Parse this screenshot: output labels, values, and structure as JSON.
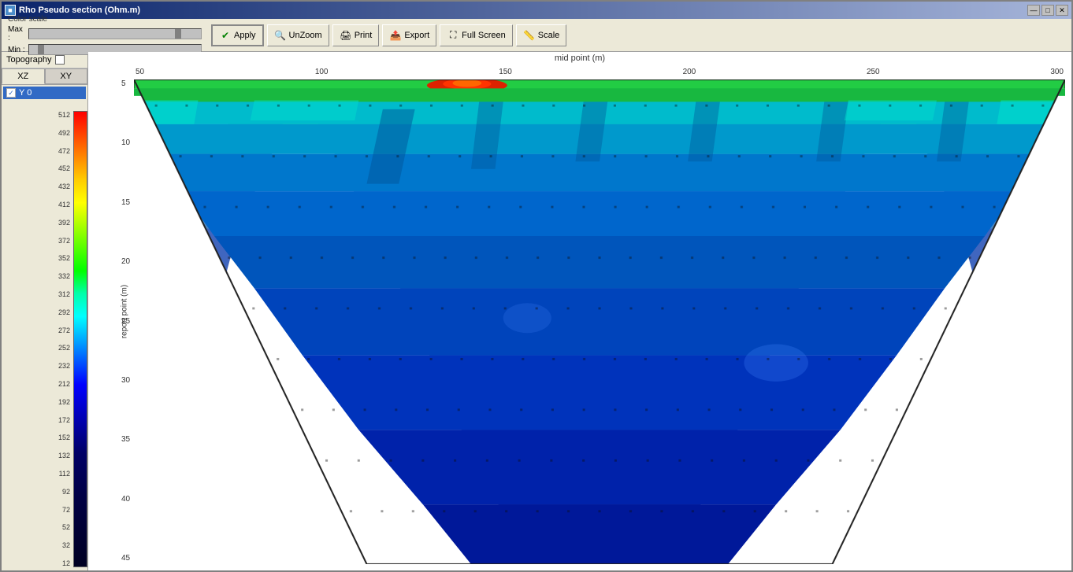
{
  "window": {
    "title": "Rho Pseudo section (Ohm.m)",
    "icon": "chart-icon"
  },
  "title_buttons": {
    "minimize": "—",
    "maximize": "□",
    "close": "✕"
  },
  "toolbar": {
    "color_scale_label": "Color scale",
    "max_label": "Max :",
    "min_label": "Min :",
    "apply_label": "Apply",
    "unzoom_label": "UnZoom",
    "print_label": "Print",
    "export_label": "Export",
    "fullscreen_label": "Full Screen",
    "scale_label": "Scale"
  },
  "left_panel": {
    "topography_label": "Topography",
    "tab_xz": "XZ",
    "tab_xy": "XY",
    "layer_item": "Y 0",
    "checkbox_checked": "✓"
  },
  "color_bar": {
    "labels": [
      "512",
      "492",
      "472",
      "452",
      "432",
      "412",
      "392",
      "372",
      "352",
      "332",
      "312",
      "292",
      "272",
      "252",
      "232",
      "212",
      "192",
      "172",
      "152",
      "132",
      "112",
      "92",
      "72",
      "52",
      "32",
      "12"
    ]
  },
  "chart": {
    "x_axis_label": "mid point (m)",
    "y_axis_label": "report point (m)",
    "x_ticks": [
      "50",
      "100",
      "150",
      "200",
      "250",
      "300"
    ],
    "y_ticks": [
      "5",
      "10",
      "15",
      "20",
      "25",
      "30",
      "35",
      "40",
      "45"
    ]
  }
}
